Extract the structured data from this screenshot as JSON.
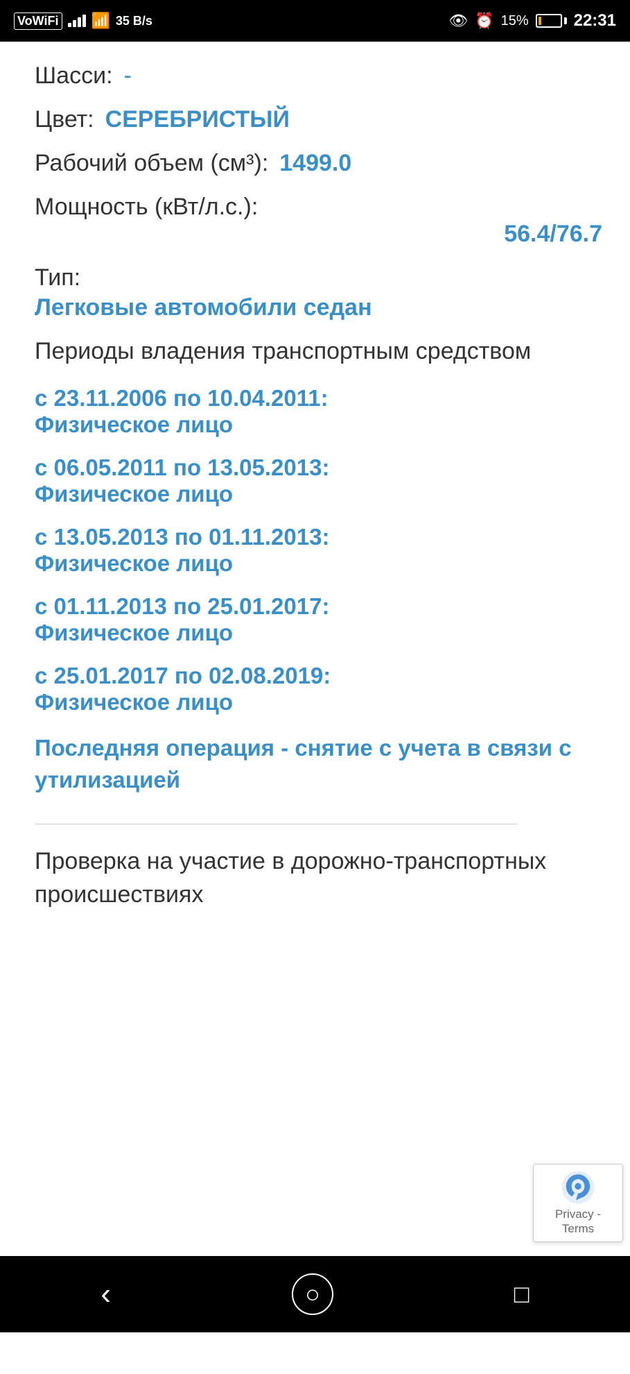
{
  "statusBar": {
    "left": {
      "voWifi": "VoWiFi",
      "signal": "signal",
      "wifi": "wifi",
      "speed": "35 B/s"
    },
    "right": {
      "eye": "👁",
      "alarm": "⏰",
      "battery": "15%",
      "time": "22:31"
    }
  },
  "fields": {
    "chassis_label": "Шасси:",
    "chassis_value": "-",
    "color_label": "Цвет:",
    "color_value": "СЕРЕБРИСТЫЙ",
    "volume_label": "Рабочий объем (см³):",
    "volume_value": "1499.0",
    "power_label": "Мощность (кВт/л.с.):",
    "power_value": "56.4/76.7",
    "type_label": "Тип:",
    "type_value": "Легковые автомобили седан",
    "ownership_header": "Периоды владения транспортным средством",
    "ownership_items": [
      {
        "period": "с 23.11.2006 по 10.04.2011:",
        "person": "Физическое лицо"
      },
      {
        "period": "с 06.05.2011 по 13.05.2013:",
        "person": "Физическое лицо"
      },
      {
        "period": "с 13.05.2013 по 01.11.2013:",
        "person": "Физическое лицо"
      },
      {
        "period": "с 01.11.2013 по 25.01.2017:",
        "person": "Физическое лицо"
      },
      {
        "period": "с 25.01.2017 по 02.08.2019:",
        "person": "Физическое лицо"
      }
    ],
    "last_operation": "Последняя операция - снятие с учета в связи с утилизацией",
    "section_title": "Проверка на участие в дорожно-транспортных происшествиях"
  },
  "recaptcha": {
    "text": "Privacy - Terms"
  },
  "navBar": {
    "back": "‹",
    "home": "○",
    "recent": "□"
  }
}
